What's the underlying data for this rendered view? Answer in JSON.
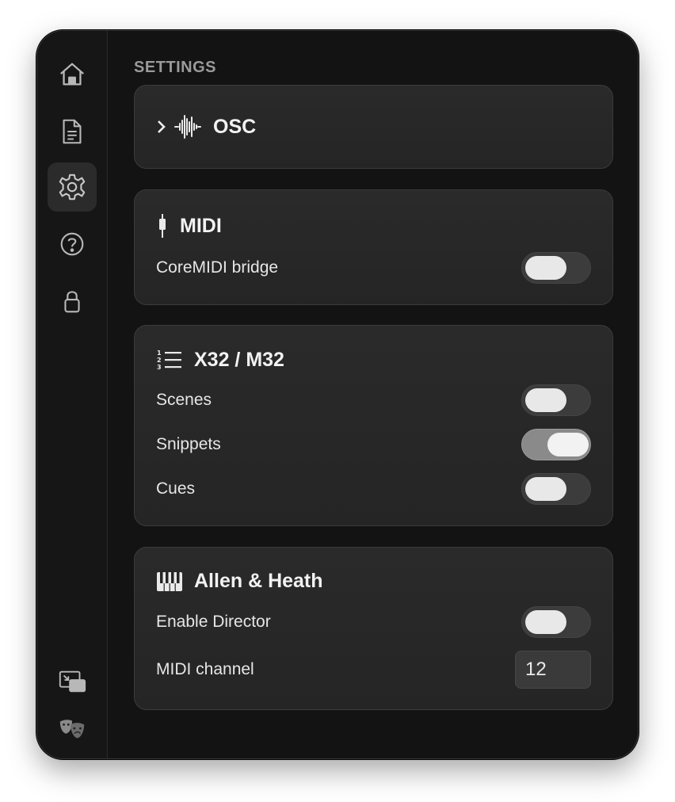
{
  "sidebar": {
    "items": [
      {
        "icon": "home-icon"
      },
      {
        "icon": "document-icon"
      },
      {
        "icon": "gear-icon",
        "active": true
      },
      {
        "icon": "help-icon"
      },
      {
        "icon": "lock-icon"
      }
    ],
    "bottom": [
      {
        "icon": "picture-in-picture-icon"
      },
      {
        "icon": "theater-masks-icon"
      }
    ]
  },
  "main": {
    "title": "SETTINGS",
    "osc": {
      "title": "OSC",
      "expanded": false
    },
    "midi": {
      "title": "MIDI",
      "rows": [
        {
          "label": "CoreMIDI bridge",
          "on": false
        }
      ]
    },
    "x32": {
      "title": "X32 / M32",
      "rows": [
        {
          "label": "Scenes",
          "on": false
        },
        {
          "label": "Snippets",
          "on": true
        },
        {
          "label": "Cues",
          "on": false
        }
      ]
    },
    "ah": {
      "title": "Allen & Heath",
      "rows": [
        {
          "label": "Enable Director",
          "on": false
        }
      ],
      "midi_channel_label": "MIDI channel",
      "midi_channel_value": "12"
    }
  },
  "colors": {
    "window_bg": "#151515",
    "card_bg": "#282828",
    "text": "#e6e6e6",
    "toggle_on": "#8a8a8a"
  }
}
